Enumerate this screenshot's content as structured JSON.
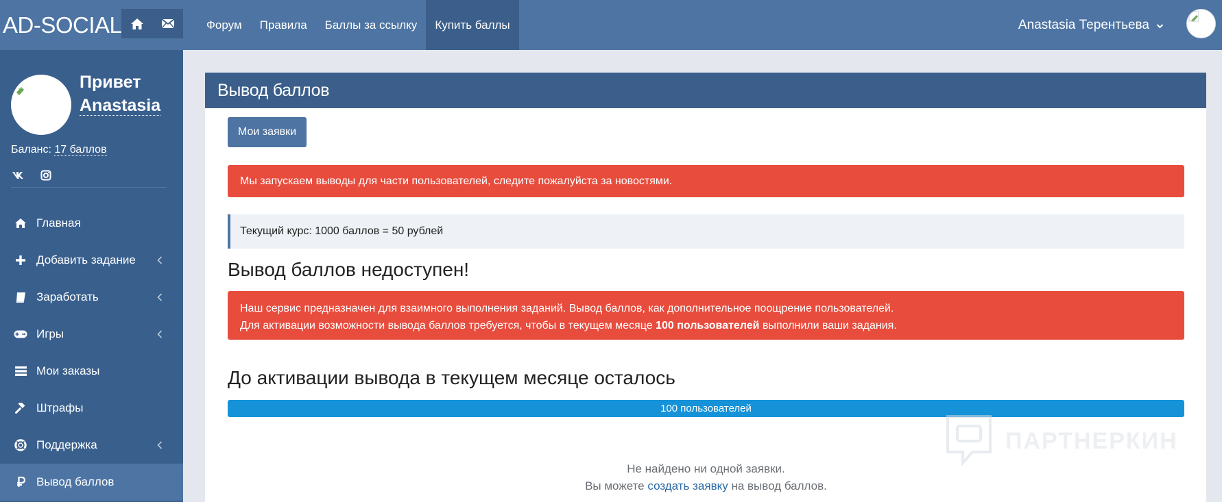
{
  "brand": {
    "logo_text": "AD-SOCIAL"
  },
  "topbar": {
    "icons": [
      "home-icon",
      "mail-icon"
    ],
    "nav": [
      {
        "label": "Форум",
        "active": false
      },
      {
        "label": "Правила",
        "active": false
      },
      {
        "label": "Баллы за ссылку",
        "active": false
      },
      {
        "label": "Купить баллы",
        "active": true
      }
    ],
    "user_name": "Anastasia Терентьева"
  },
  "sidebar": {
    "greeting": "Привет",
    "name": "Anastasia",
    "balance_label": "Баланс:",
    "balance_value": "17 баллов",
    "socials": [
      "vk-icon",
      "instagram-icon"
    ],
    "items": [
      {
        "label": "Главная",
        "icon": "home-icon",
        "has_submenu": false,
        "active": false
      },
      {
        "label": "Добавить задание",
        "icon": "plus-icon",
        "has_submenu": true,
        "active": false
      },
      {
        "label": "Заработать",
        "icon": "book-icon",
        "has_submenu": true,
        "active": false
      },
      {
        "label": "Игры",
        "icon": "gamepad-icon",
        "has_submenu": true,
        "active": false
      },
      {
        "label": "Мои заказы",
        "icon": "list-icon",
        "has_submenu": false,
        "active": false
      },
      {
        "label": "Штрафы",
        "icon": "gavel-icon",
        "has_submenu": false,
        "active": false
      },
      {
        "label": "Поддержка",
        "icon": "lifebuoy-icon",
        "has_submenu": true,
        "active": false
      },
      {
        "label": "Вывод баллов",
        "icon": "ruble-icon",
        "has_submenu": false,
        "active": true
      }
    ]
  },
  "main": {
    "title": "Вывод баллов",
    "my_requests_button": "Мои заявки",
    "alert_launch": "Мы запускаем выводы для части пользователей, следите пожалуйста за новостями.",
    "rate_text": "Текущий курс: 1000 баллов = 50 рублей",
    "unavailable_heading": "Вывод баллов недоступен!",
    "info_line1": "Наш сервис предназначен для взаимного выполнения заданий. Вывод баллов, как дополнительное поощрение пользователей.",
    "info_line2_prefix": "Для активации возможности вывода баллов требуется, чтобы в текущем месяце ",
    "info_line2_bold": "100 пользователей",
    "info_line2_suffix": " выполнили ваши задания.",
    "remaining_heading": "До активации вывода в текущем месяце осталось",
    "progress_label": "100 пользователей",
    "progress_percent": 100,
    "empty_line1": "Не найдено ни одной заявки.",
    "empty_line2_prefix": "Вы можете ",
    "empty_line2_link": "создать заявку",
    "empty_line2_suffix": " на вывод баллов."
  },
  "watermark": {
    "text": "ПАРТНЕРКИН"
  },
  "colors": {
    "topbar": "#4d74a3",
    "sidebar": "#395f8d",
    "panel_header": "#3b5f8a",
    "alert_red": "#e84c3d",
    "progress_blue": "#1692d8"
  }
}
